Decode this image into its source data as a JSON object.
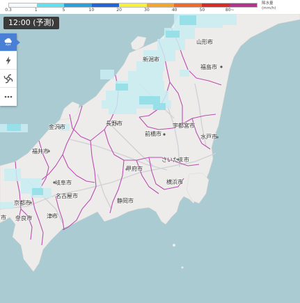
{
  "legend": {
    "colors": [
      "#f4fbfd",
      "#5fe1ef",
      "#2a9fd8",
      "#2164d8",
      "#f5f03a",
      "#f3a629",
      "#ef6a2a",
      "#d62b29",
      "#b3338f"
    ],
    "ticks": [
      "0.3",
      "1",
      "5",
      "10",
      "20",
      "30",
      "40",
      "50",
      "80~"
    ],
    "unit_line1": "降水量",
    "unit_line2": "(mm/h)"
  },
  "time_label": "12:00 (予測)",
  "toolbar": {
    "items": [
      "rain-cloud-icon",
      "lightning-icon",
      "typhoon-icon",
      "more-icon"
    ],
    "active_color": "#4a7fd6"
  },
  "cities": {
    "yamagata": "山形市",
    "niigata": "新潟市",
    "fukushima": "福島市",
    "kanazawa": "金沢市",
    "nagano": "長野市",
    "utsunomiya": "宇都宮市",
    "maebashi": "前橋市",
    "mito": "水戸市",
    "fukui": "福井市",
    "saitama": "さいたま市",
    "kofu": "甲府市",
    "gifu": "岐阜市",
    "yokohama": "横浜市",
    "nagoya": "名古屋市",
    "shizuoka": "静岡市",
    "kyoto": "京都市",
    "tsu": "津市",
    "nara": "奈良市",
    "osaka_fragment": "市"
  },
  "colors": {
    "sea": "#aacbd2",
    "land": "#eeecea",
    "boundary": "#b84fb0",
    "road": "#cfd2d6",
    "rain_light": "#c9eef3",
    "rain_mid": "#93dfe8"
  }
}
